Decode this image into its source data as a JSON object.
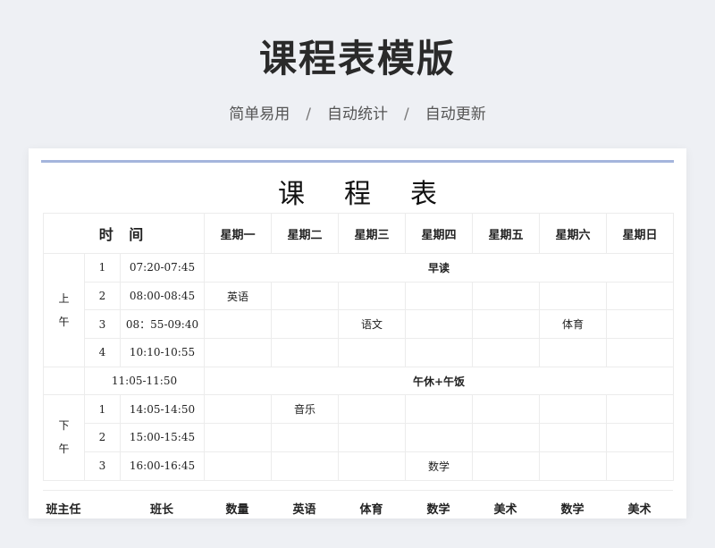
{
  "header": {
    "title": "课程表模版",
    "subtitle": [
      "简单易用",
      "自动统计",
      "自动更新"
    ],
    "separator": "/"
  },
  "sheet": {
    "title_chars": [
      "课",
      "程",
      "表"
    ],
    "time_header": "时 间",
    "days": [
      "星期一",
      "星期二",
      "星期三",
      "星期四",
      "星期五",
      "星期六",
      "星期日"
    ],
    "morning_label": [
      "上",
      "午"
    ],
    "afternoon_label": [
      "下",
      "午"
    ],
    "morning": [
      {
        "num": "1",
        "time": "07:20-07:45",
        "merged": "早读"
      },
      {
        "num": "2",
        "time": "08:00-08:45",
        "cells": [
          "英语",
          "",
          "",
          "",
          "",
          "",
          ""
        ]
      },
      {
        "num": "3",
        "time": "08：55-09:40",
        "cells": [
          "",
          "",
          "语文",
          "",
          "",
          "体育",
          ""
        ]
      },
      {
        "num": "4",
        "time": "10:10-10:55",
        "cells": [
          "",
          "",
          "",
          "",
          "",
          "",
          ""
        ]
      }
    ],
    "break": {
      "time": "11:05-11:50",
      "label": "午休+午饭"
    },
    "afternoon": [
      {
        "num": "1",
        "time": "14:05-14:50",
        "cells": [
          "",
          "音乐",
          "",
          "",
          "",
          "",
          ""
        ]
      },
      {
        "num": "2",
        "time": "15:00-15:45",
        "cells": [
          "",
          "",
          "",
          "",
          "",
          "",
          ""
        ]
      },
      {
        "num": "3",
        "time": "16:00-16:45",
        "cells": [
          "",
          "",
          "",
          "数学",
          "",
          "",
          ""
        ]
      }
    ],
    "footer": [
      "班主任",
      "班长",
      "数量",
      "英语",
      "体育",
      "数学",
      "美术",
      "数学",
      "美术"
    ]
  }
}
